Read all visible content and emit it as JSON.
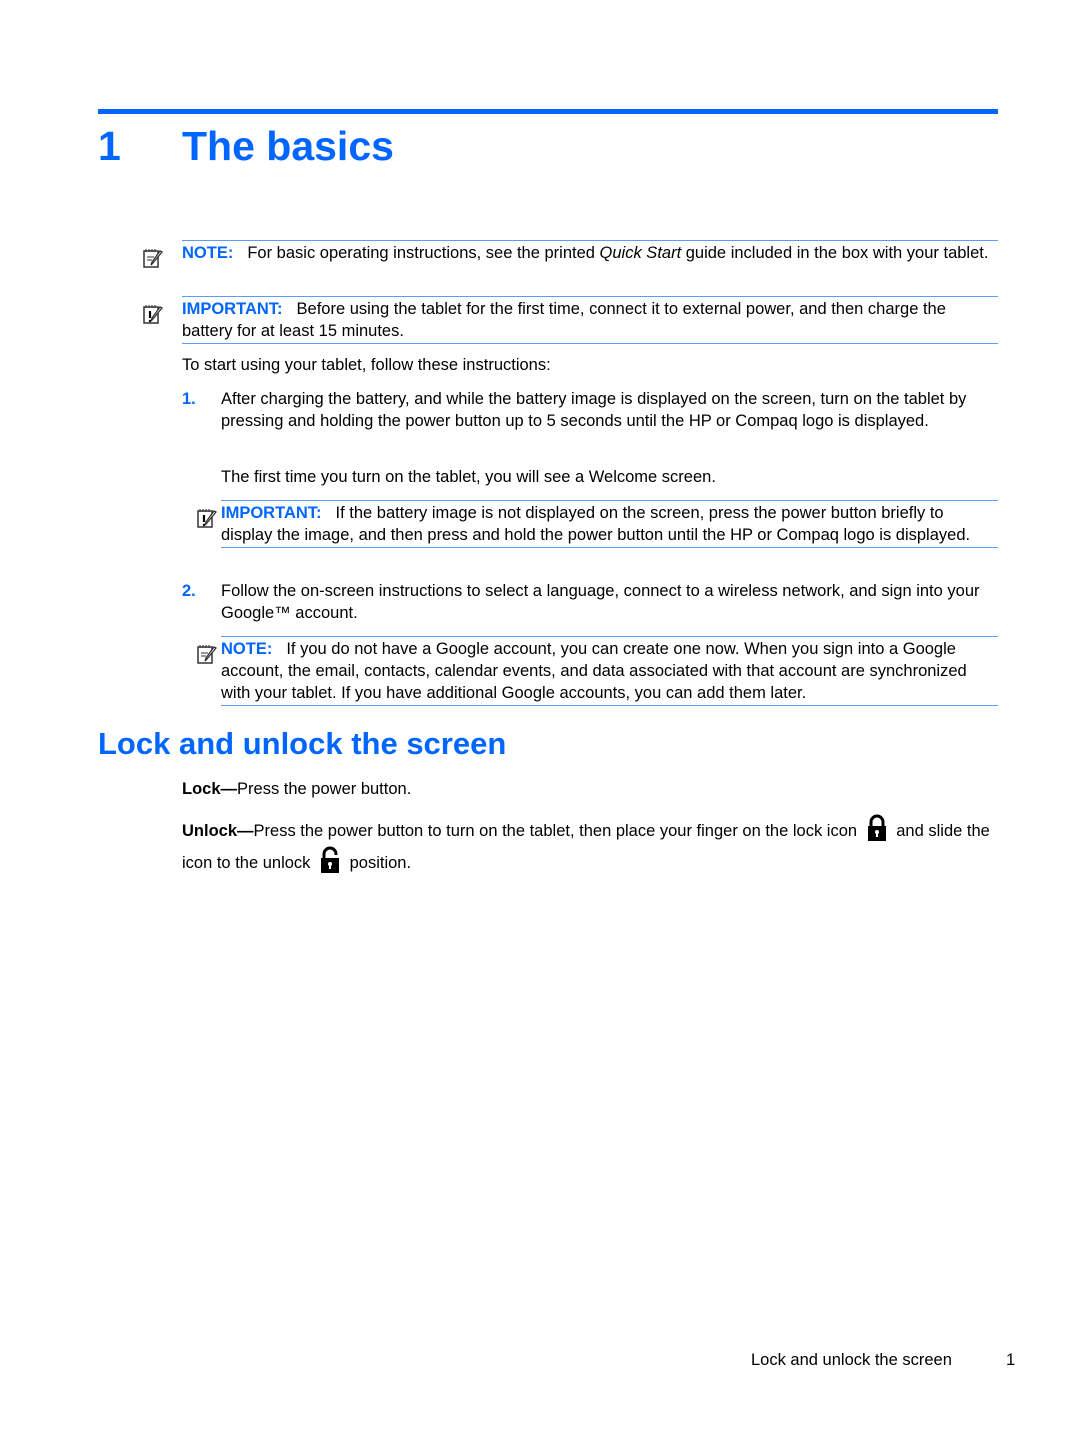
{
  "chapter": {
    "number": "1",
    "title": "The basics"
  },
  "notes": [
    {
      "label": "NOTE:",
      "icon": "note-pencil-icon",
      "text_before": "For basic operating instructions, see the printed ",
      "emphasis": "Quick Start",
      "text_after": " guide included in the box with your tablet."
    },
    {
      "label": "IMPORTANT:",
      "icon": "important-pencil-icon",
      "text": "Before using the tablet for the first time, connect it to external power, and then charge the battery for at least 15 minutes."
    }
  ],
  "intro": "To start using your tablet, follow these instructions:",
  "steps": [
    {
      "number": "1.",
      "text": "After charging the battery, and while the battery image is displayed on the screen, turn on the tablet by pressing and holding the power button up to 5 seconds until the HP or Compaq logo is displayed.",
      "followup": "The first time you turn on the tablet, you will see a Welcome screen.",
      "callout": {
        "label": "IMPORTANT:",
        "icon": "important-pencil-icon",
        "text": "If the battery image is not displayed on the screen, press the power button briefly to display the image, and then press and hold the power button until the HP or Compaq logo is displayed."
      }
    },
    {
      "number": "2.",
      "text": "Follow the on-screen instructions to select a language, connect to a wireless network, and sign into your Google™ account.",
      "callout": {
        "label": "NOTE:",
        "icon": "note-pencil-icon",
        "text": "If you do not have a Google account, you can create one now. When you sign into a Google account, the email, contacts, calendar events, and data associated with that account are synchronized with your tablet. If you have additional Google accounts, you can add them later."
      }
    }
  ],
  "section": {
    "title": "Lock and unlock the screen",
    "lock": {
      "term": "Lock—",
      "text": "Press the power button."
    },
    "unlock": {
      "term": "Unlock—",
      "text_before": "Press the power button to turn on the tablet, then place your finger on the lock icon",
      "icon1": "padlock-closed-icon",
      "text_middle": "and slide the icon to the unlock",
      "icon2": "padlock-open-icon",
      "text_after": "position."
    }
  },
  "footer": {
    "section_title": "Lock and unlock the screen",
    "page_number": "1"
  },
  "colors": {
    "accent": "#0066ff",
    "rule": "#5b9bff",
    "text": "#000000"
  }
}
